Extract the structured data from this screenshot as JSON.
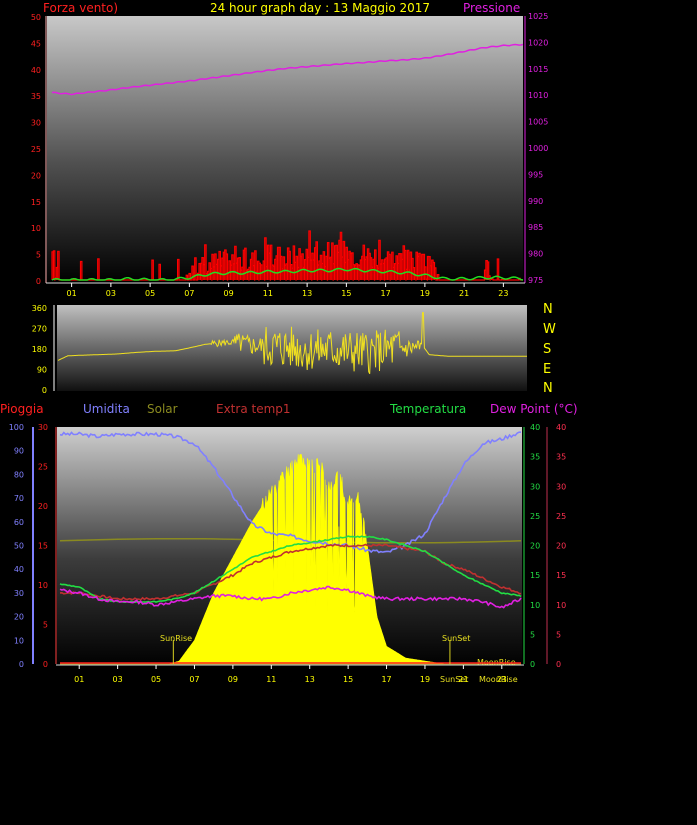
{
  "header": {
    "left_title": "Forza vento)",
    "center_title": "24 hour graph day : 13 Maggio 2017",
    "right_title": "Pressione"
  },
  "colors": {
    "wind": "#ff0000",
    "gust": "#ff2a2a",
    "wind_avg": "#22dd22",
    "pressure": "#e020e0",
    "direction": "#f0e020",
    "rain": "#ff2020",
    "humidity": "#8080ff",
    "solar": "#ffff00",
    "solar_ref": "#8a8a20",
    "extra_temp": "#c03030",
    "temperature": "#22dd44",
    "dew_point": "#e020e0",
    "tick": "#ffff00"
  },
  "compass": [
    "N",
    "W",
    "S",
    "E",
    "N"
  ],
  "bottom_legend": {
    "rain": "Pioggia",
    "humidity": "Umidita",
    "solar": "Solar",
    "extra_temp": "Extra temp1",
    "temperature": "Temperatura",
    "dew_point": "Dew Point (°C)"
  },
  "annotations": {
    "sunrise": "SunRise",
    "sunset": "SunSet",
    "moonrise": "MoonRise",
    "moonset": "MoonSet"
  },
  "x_ticks": [
    "01",
    "03",
    "05",
    "07",
    "09",
    "11",
    "13",
    "15",
    "17",
    "19",
    "21",
    "23"
  ],
  "chart_data": [
    {
      "type": "line",
      "x_unit": "hour",
      "y_left": {
        "ticks": [
          "0",
          "5",
          "10",
          "15",
          "20",
          "25",
          "30",
          "35",
          "40",
          "45",
          "50"
        ],
        "ylim": [
          0,
          50
        ]
      },
      "y_right": {
        "ticks": [
          "975",
          "980",
          "985",
          "990",
          "995",
          "1000",
          "1005",
          "1010",
          "1015",
          "1020",
          "1025"
        ],
        "ylim": [
          975,
          1025
        ]
      },
      "series": [
        {
          "name": "Pressione",
          "axis": "right",
          "x": [
            0,
            1,
            2,
            3,
            4,
            5,
            6,
            7,
            8,
            9,
            10,
            11,
            12,
            13,
            14,
            15,
            16,
            17,
            18,
            19,
            20,
            21,
            22,
            23,
            24
          ],
          "values": [
            1010.5,
            1010.2,
            1010.6,
            1011,
            1011.5,
            1011.9,
            1012.3,
            1012.7,
            1013.2,
            1013.7,
            1014.2,
            1014.7,
            1015.1,
            1015.4,
            1015.7,
            1016,
            1016.2,
            1016.5,
            1016.7,
            1017,
            1017.6,
            1018.3,
            1019,
            1019.4,
            1019.6
          ]
        },
        {
          "name": "Forza vento)",
          "axis": "left",
          "x": [
            0,
            1,
            2,
            3,
            4,
            5,
            6,
            7,
            8,
            9,
            10,
            11,
            12,
            13,
            14,
            15,
            16,
            17,
            18,
            19,
            20,
            21,
            22,
            23,
            24
          ],
          "values": [
            0,
            0,
            0,
            0,
            0.5,
            0,
            0,
            1,
            2.5,
            3,
            3,
            3.5,
            3.5,
            4,
            4,
            4.5,
            4,
            3.5,
            3,
            2,
            0.5,
            0.5,
            1,
            1,
            0.5
          ]
        }
      ]
    },
    {
      "type": "line",
      "x_unit": "hour",
      "y_left": {
        "ticks": [
          "0",
          "90",
          "180",
          "270",
          "360"
        ],
        "ylim": [
          0,
          360
        ]
      },
      "series": [
        {
          "name": "direction",
          "x": [
            0,
            0.5,
            1,
            2,
            3,
            4,
            5,
            6,
            7,
            7.5,
            8,
            9,
            10,
            11,
            12,
            13,
            14,
            15,
            16,
            17,
            18,
            18.7,
            19,
            20,
            21,
            22,
            23,
            24
          ],
          "values": [
            130,
            150,
            152,
            155,
            158,
            165,
            170,
            172,
            190,
            200,
            205,
            210,
            195,
            190,
            185,
            175,
            180,
            170,
            165,
            180,
            185,
            190,
            155,
            148,
            148,
            148,
            148,
            148
          ]
        }
      ]
    },
    {
      "type": "line",
      "x_unit": "hour",
      "y_left": {
        "ticks": [
          "0",
          "10",
          "20",
          "30",
          "40",
          "50",
          "60",
          "70",
          "80",
          "90",
          "100"
        ],
        "ylim": [
          0,
          100
        ]
      },
      "y_rain": {
        "ticks": [
          "0",
          "5",
          "10",
          "15",
          "20",
          "25",
          "30"
        ],
        "ylim": [
          0,
          30
        ]
      },
      "y_right": {
        "ticks": [
          "0",
          "5",
          "10",
          "15",
          "20",
          "25",
          "30",
          "35",
          "40"
        ],
        "ylim": [
          0,
          40
        ]
      },
      "y_right2": {
        "ticks": [
          "0",
          "5",
          "10",
          "15",
          "20",
          "25",
          "30",
          "35",
          "40"
        ],
        "ylim": [
          0,
          40
        ]
      },
      "series": [
        {
          "name": "Umidita",
          "axis": "left",
          "x": [
            0,
            1,
            2,
            3,
            4,
            5,
            6,
            7,
            8,
            9,
            10,
            11,
            12,
            13,
            14,
            15,
            16,
            17,
            18,
            19,
            20,
            21,
            22,
            23,
            24
          ],
          "values": [
            97,
            97,
            96,
            97,
            97,
            97,
            96,
            93,
            83,
            71,
            59,
            55,
            54,
            52,
            51,
            50,
            48,
            47,
            50,
            55,
            70,
            84,
            93,
            95,
            98
          ]
        },
        {
          "name": "Solar",
          "axis": "right",
          "x": [
            0,
            5.7,
            6.2,
            7,
            8,
            9,
            10,
            11,
            12,
            12.5,
            13,
            13.5,
            14,
            14.5,
            15,
            15.5,
            16,
            16.5,
            17,
            18,
            19,
            20,
            21,
            22,
            23,
            24
          ],
          "values": [
            0,
            0,
            0.5,
            4,
            12,
            18,
            24,
            29,
            33,
            35,
            33,
            34,
            30,
            32,
            27,
            28,
            20,
            8,
            3,
            1,
            0.5,
            0,
            0,
            0,
            0,
            0
          ]
        },
        {
          "name": "Temperatura",
          "axis": "right",
          "x": [
            0,
            1,
            2,
            3,
            4,
            5,
            6,
            7,
            8,
            9,
            10,
            11,
            12,
            13,
            14,
            15,
            16,
            17,
            18,
            19,
            20,
            21,
            22,
            23,
            24
          ],
          "values": [
            13.5,
            13,
            11,
            10.5,
            10.5,
            10.5,
            11,
            12,
            14,
            16,
            18,
            19,
            20,
            20.5,
            21,
            21.5,
            21.5,
            21,
            20,
            19,
            17,
            15,
            13.5,
            12,
            11.5
          ]
        },
        {
          "name": "Extra temp1",
          "axis": "right2",
          "x": [
            0,
            1,
            2,
            3,
            4,
            5,
            6,
            7,
            8,
            9,
            10,
            11,
            12,
            13,
            14,
            15,
            16,
            17,
            18,
            19,
            20,
            21,
            22,
            23,
            24
          ],
          "values": [
            12,
            12,
            11.5,
            11,
            11,
            11,
            11.5,
            12,
            13.5,
            15,
            17,
            18,
            19,
            19.5,
            20,
            20,
            20,
            20,
            19.5,
            19,
            17,
            16,
            14.5,
            13,
            12
          ]
        },
        {
          "name": "Dew Point (°C)",
          "axis": "right",
          "x": [
            0,
            1,
            2,
            3,
            4,
            5,
            6,
            7,
            8,
            9,
            10,
            11,
            12,
            13,
            14,
            15,
            16,
            17,
            18,
            19,
            20,
            21,
            22,
            23,
            24
          ],
          "values": [
            12.5,
            12,
            11,
            10.5,
            10.5,
            10,
            10.5,
            11,
            11.5,
            11.5,
            11,
            11,
            12,
            12.5,
            13,
            12.5,
            11.5,
            11,
            11,
            11,
            11,
            11,
            10.5,
            9.5,
            11
          ]
        },
        {
          "name": "Pioggia",
          "axis": "rain",
          "x": [
            0,
            24
          ],
          "values": [
            0,
            0
          ]
        }
      ]
    }
  ]
}
